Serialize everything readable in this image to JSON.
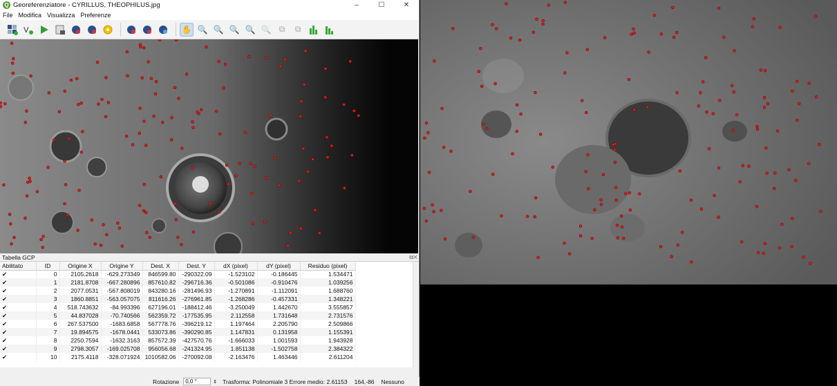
{
  "window": {
    "title": "Georeferenziatore - CYRILLUS, THEOPHILUS.jpg",
    "minimize": "–",
    "maximize": "☐",
    "close": "✕"
  },
  "menu": [
    "File",
    "Modifica",
    "Visualizza",
    "Preferenze"
  ],
  "toolbar_icons": [
    "open-raster-icon",
    "load-gcp-icon",
    "start-icon",
    "generate-script-icon",
    "save-gcp-icon",
    "save-gcp-as-icon",
    "settings-icon",
    "add-point-icon",
    "delete-point-icon",
    "move-point-icon",
    "pan-icon",
    "zoom-in-icon",
    "zoom-out-icon",
    "zoom-layer-icon",
    "zoom-last-icon",
    "zoom-next-icon",
    "link-georef-icon",
    "link-qgis-icon",
    "histogram-stretch-icon",
    "histogram-local-icon"
  ],
  "gcp_panel": {
    "title": "Tabella GCP",
    "columns": [
      "Abilitato",
      "ID",
      "Origine X",
      "Origine Y",
      "Dest. X",
      "Dest. Y",
      "dX (pixel)",
      "dY (pixel)",
      "Residuo (pixel)"
    ],
    "rows": [
      [
        "✔",
        "0",
        "2105.2618",
        "-629.273349",
        "846599.80",
        "-290322.09",
        "-1.523102",
        "-0.186445",
        "1.534471"
      ],
      [
        "✔",
        "1",
        "2181.8708",
        "-667.280896",
        "857610.82",
        "-296716.36",
        "-0.501086",
        "-0.910476",
        "1.039256"
      ],
      [
        "✔",
        "2",
        "2077.0531",
        "-567.808019",
        "843280.16",
        "-281496.93",
        "-1.270891",
        "-1.112091",
        "1.688760"
      ],
      [
        "✔",
        "3",
        "1860.8851",
        "-563.057075",
        "811616.26",
        "-276961.85",
        "-1.268286",
        "-0.457331",
        "1.348221"
      ],
      [
        "✔",
        "4",
        "518.743632",
        "-84.993396",
        "627196.01",
        "-188412.46",
        "-3.250049",
        "1.442670",
        "3.555857"
      ],
      [
        "✔",
        "5",
        "44.837028",
        "-70.740566",
        "562359.72",
        "-177535.95",
        "2.112558",
        "1.731648",
        "2.731576"
      ],
      [
        "✔",
        "6",
        "267.537500",
        "-1683.6858",
        "567778.76",
        "-396219.12",
        "1.197464",
        "2.205790",
        "2.509866"
      ],
      [
        "✔",
        "7",
        "19.894575",
        "-1678.0441",
        "533073.86",
        "-390290.85",
        "1.147831",
        "0.131958",
        "1.155391"
      ],
      [
        "✔",
        "8",
        "2250.7594",
        "-1632.3163",
        "857572.39",
        "-427570.76",
        "-1.666033",
        "1.001593",
        "1.943928"
      ],
      [
        "✔",
        "9",
        "2798.3057",
        "-169.025708",
        "956056.68",
        "-241324.95",
        "1.851138",
        "-1.502758",
        "2.384322"
      ],
      [
        "✔",
        "10",
        "2175.4118",
        "-328.071924",
        "1010582.06",
        "-270092.08",
        "-2.163476",
        "1.463446",
        "2.611204"
      ]
    ]
  },
  "status": {
    "rotation_label": "Rotazione",
    "rotation_value": "0,0 °",
    "transform": "Trasforma: Polinomiale 3 Errore medio: 2.61153",
    "coords": "164,-86",
    "crs": "Nessuno"
  }
}
